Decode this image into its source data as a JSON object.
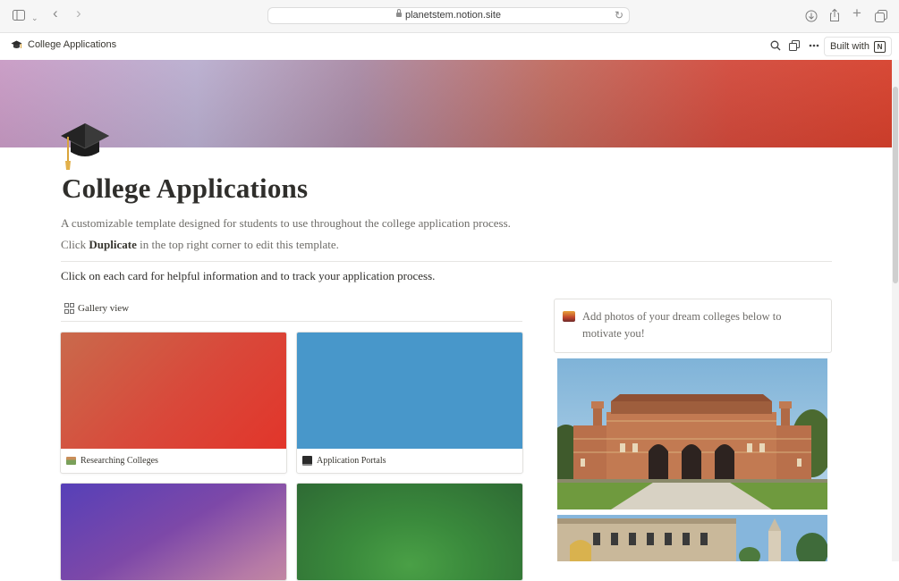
{
  "browser": {
    "url": "planetstem.notion.site",
    "icons": [
      "sidebar-icon",
      "chevron-down-icon",
      "back-icon",
      "forward-icon",
      "lock-icon",
      "reload-icon",
      "download-icon",
      "share-icon",
      "new-tab-icon",
      "tabs-overview-icon"
    ]
  },
  "topbar": {
    "breadcrumb": "College Applications",
    "built_with": "Built with",
    "icons": [
      "search-icon",
      "duplicate-icon",
      "more-icon",
      "notion-logo-icon"
    ]
  },
  "page": {
    "title": "College Applications",
    "description_line1": "A customizable template designed for students to use throughout the college application process.",
    "description_line2_pre": "Click ",
    "description_line2_bold": "Duplicate",
    "description_line2_post": " in the top right corner to edit this template.",
    "instruction": "Click on each card for helpful information and to track your application process."
  },
  "gallery": {
    "view_label": "Gallery view",
    "cards": [
      {
        "title": "Researching Colleges",
        "color_from": "#cf6a48",
        "color_to": "#e0352a"
      },
      {
        "title": "Application Portals",
        "color_from": "#4a98cb",
        "color_to": "#4a98cb"
      },
      {
        "title": "",
        "color_from": "#5e3fb8",
        "color_to": "#c48aa0"
      },
      {
        "title": "",
        "color_from": "#2f7a3a",
        "color_to": "#6ea543"
      }
    ]
  },
  "callout": {
    "text": "Add photos of your dream colleges below to motivate you!"
  },
  "colors": {
    "text": "#37352f",
    "muted": "#6e6c68",
    "cover_left": "#c89ac4",
    "cover_right": "#d6402c"
  }
}
